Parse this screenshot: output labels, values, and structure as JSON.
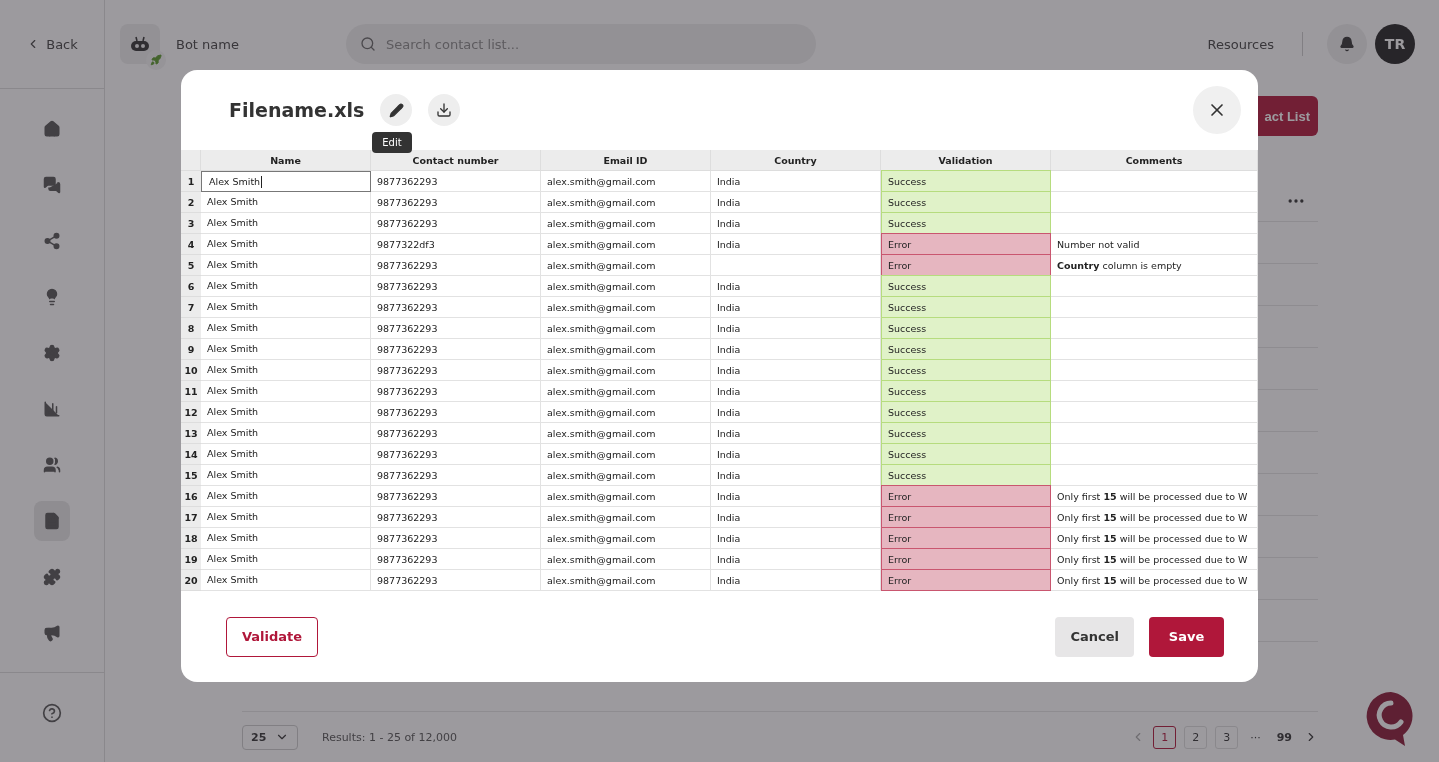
{
  "sidebar": {
    "back": "Back",
    "items": [
      {
        "selected": false
      },
      {
        "selected": false
      },
      {
        "selected": false
      },
      {
        "selected": false
      },
      {
        "selected": false
      },
      {
        "selected": false
      },
      {
        "selected": false
      },
      {
        "selected": true
      },
      {
        "selected": false
      },
      {
        "selected": false
      }
    ]
  },
  "topbar": {
    "bot_name": "Bot name",
    "search": {
      "placeholder": "Search contact list..."
    },
    "resources": "Resources",
    "avatar": "TR"
  },
  "page": {
    "create_button": "act List",
    "pagination": {
      "page_size": "25",
      "results": "Results: 1 - 25 of 12,000",
      "pages": [
        {
          "label": "1",
          "kind": "page",
          "selected": true
        },
        {
          "label": "2",
          "kind": "page",
          "selected": false
        },
        {
          "label": "3",
          "kind": "page",
          "selected": false
        },
        {
          "label": "···",
          "kind": "gap"
        },
        {
          "label": "99",
          "kind": "plain",
          "selected": false
        }
      ]
    }
  },
  "modal": {
    "title": "Filename.xls",
    "tooltip": "Edit",
    "table": {
      "columns": [
        "Name",
        "Contact number",
        "Email ID",
        "Country",
        "Validation",
        "Comments"
      ],
      "rows": [
        {
          "index": "1",
          "name": "Alex Smith",
          "editing": true,
          "contact": "9877362293",
          "email": "alex.smith@gmail.com",
          "country": "India",
          "validation": {
            "text": "Success",
            "kind": "success"
          }
        },
        {
          "index": "2",
          "name": "Alex Smith",
          "editing": false,
          "contact": "9877362293",
          "email": "alex.smith@gmail.com",
          "country": "India",
          "validation": {
            "text": "Success",
            "kind": "success"
          }
        },
        {
          "index": "3",
          "name": "Alex Smith",
          "editing": false,
          "contact": "9877362293",
          "email": "alex.smith@gmail.com",
          "country": "India",
          "validation": {
            "text": "Success",
            "kind": "success"
          }
        },
        {
          "index": "4",
          "name": "Alex Smith",
          "editing": false,
          "contact": "9877322df3",
          "email": "alex.smith@gmail.com",
          "country": "India",
          "validation": {
            "text": "Error",
            "kind": "error"
          },
          "comment": "Number not valid"
        },
        {
          "index": "5",
          "name": "Alex Smith",
          "editing": false,
          "contact": "9877362293",
          "email": "alex.smith@gmail.com",
          "validation": {
            "text": "Error",
            "kind": "error"
          },
          "comment": "**Country** column is empty"
        },
        {
          "index": "6",
          "name": "Alex Smith",
          "editing": false,
          "contact": "9877362293",
          "email": "alex.smith@gmail.com",
          "country": "India",
          "validation": {
            "text": "Success",
            "kind": "success"
          }
        },
        {
          "index": "7",
          "name": "Alex Smith",
          "editing": false,
          "contact": "9877362293",
          "email": "alex.smith@gmail.com",
          "country": "India",
          "validation": {
            "text": "Success",
            "kind": "success"
          }
        },
        {
          "index": "8",
          "name": "Alex Smith",
          "editing": false,
          "contact": "9877362293",
          "email": "alex.smith@gmail.com",
          "country": "India",
          "validation": {
            "text": "Success",
            "kind": "success"
          }
        },
        {
          "index": "9",
          "name": "Alex Smith",
          "editing": false,
          "contact": "9877362293",
          "email": "alex.smith@gmail.com",
          "country": "India",
          "validation": {
            "text": "Success",
            "kind": "success"
          }
        },
        {
          "index": "10",
          "name": "Alex Smith",
          "editing": false,
          "contact": "9877362293",
          "email": "alex.smith@gmail.com",
          "country": "India",
          "validation": {
            "text": "Success",
            "kind": "success"
          }
        },
        {
          "index": "11",
          "name": "Alex Smith",
          "editing": false,
          "contact": "9877362293",
          "email": "alex.smith@gmail.com",
          "country": "India",
          "validation": {
            "text": "Success",
            "kind": "success"
          }
        },
        {
          "index": "12",
          "name": "Alex Smith",
          "editing": false,
          "contact": "9877362293",
          "email": "alex.smith@gmail.com",
          "country": "India",
          "validation": {
            "text": "Success",
            "kind": "success"
          }
        },
        {
          "index": "13",
          "name": "Alex Smith",
          "editing": false,
          "contact": "9877362293",
          "email": "alex.smith@gmail.com",
          "country": "India",
          "validation": {
            "text": "Success",
            "kind": "success"
          }
        },
        {
          "index": "14",
          "name": "Alex Smith",
          "editing": false,
          "contact": "9877362293",
          "email": "alex.smith@gmail.com",
          "country": "India",
          "validation": {
            "text": "Success",
            "kind": "success"
          }
        },
        {
          "index": "15",
          "name": "Alex Smith",
          "editing": false,
          "contact": "9877362293",
          "email": "alex.smith@gmail.com",
          "country": "India",
          "validation": {
            "text": "Success",
            "kind": "success"
          }
        },
        {
          "index": "16",
          "name": "Alex Smith",
          "editing": false,
          "contact": "9877362293",
          "email": "alex.smith@gmail.com",
          "country": "India",
          "validation": {
            "text": "Error",
            "kind": "error"
          },
          "comment": "Only first **15** will be processed due to W"
        },
        {
          "index": "17",
          "name": "Alex Smith",
          "editing": false,
          "contact": "9877362293",
          "email": "alex.smith@gmail.com",
          "country": "India",
          "validation": {
            "text": "Error",
            "kind": "error"
          },
          "comment": "Only first **15** will be processed due to W"
        },
        {
          "index": "18",
          "name": "Alex Smith",
          "editing": false,
          "contact": "9877362293",
          "email": "alex.smith@gmail.com",
          "country": "India",
          "validation": {
            "text": "Error",
            "kind": "error"
          },
          "comment": "Only first **15** will be processed due to W"
        },
        {
          "index": "19",
          "name": "Alex Smith",
          "editing": false,
          "contact": "9877362293",
          "email": "alex.smith@gmail.com",
          "country": "India",
          "validation": {
            "text": "Error",
            "kind": "error"
          },
          "comment": "Only first **15** will be processed due to W"
        },
        {
          "index": "20",
          "name": "Alex Smith",
          "editing": false,
          "contact": "9877362293",
          "email": "alex.smith@gmail.com",
          "country": "India",
          "validation": {
            "text": "Error",
            "kind": "error"
          },
          "comment": "Only first **15** will be processed due to W"
        }
      ]
    },
    "buttons": {
      "validate": "Validate",
      "cancel": "Cancel",
      "save": "Save"
    }
  }
}
